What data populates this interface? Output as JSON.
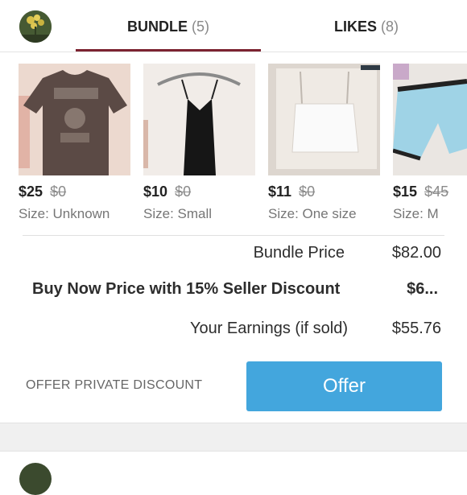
{
  "tabs": [
    {
      "label": "BUNDLE",
      "count": "(5)"
    },
    {
      "label": "LIKES",
      "count": "(8)"
    }
  ],
  "items": [
    {
      "price": "$25",
      "original_price": "$0",
      "size": "Size: Unknown"
    },
    {
      "price": "$10",
      "original_price": "$0",
      "size": "Size: Small"
    },
    {
      "price": "$11",
      "original_price": "$0",
      "size": "Size: One size"
    },
    {
      "price": "$15",
      "original_price": "$45",
      "size": "Size: M"
    }
  ],
  "summary": {
    "bundle_price_label": "Bundle Price",
    "bundle_price_value": "$82.00",
    "buy_now_label": "Buy Now Price with 15% Seller Discount",
    "buy_now_value": "$6...",
    "earnings_label": "Your Earnings (if sold)",
    "earnings_value": "$55.76"
  },
  "actions": {
    "offer_private_label": "OFFER PRIVATE DISCOUNT",
    "offer_button_label": "Offer"
  },
  "colors": {
    "accent_underline": "#7c2331",
    "offer_button": "#43a6dd"
  }
}
